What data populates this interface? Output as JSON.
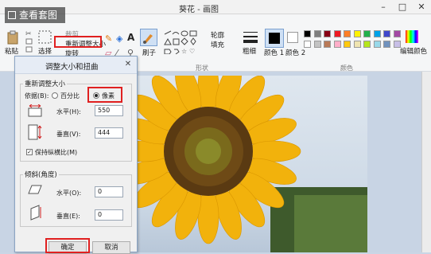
{
  "window": {
    "title": "葵花 - 画图",
    "watermark": "查看套图"
  },
  "ribbon": {
    "paste_label": "粘贴",
    "select_label": "选择",
    "crop_label": "裁剪",
    "resize_label": "重新调整大小",
    "rotate_label": "旋转",
    "brush_label": "刷子",
    "shapes_group": "形状",
    "outline_label": "轮廓",
    "fill_label": "填充",
    "size_label": "粗细",
    "color1_label": "颜色 1",
    "color2_label": "颜色 2",
    "colors_group": "颜色",
    "edit_colors_label": "编辑颜色",
    "palette": [
      "#000000",
      "#7f7f7f",
      "#880015",
      "#ed1c24",
      "#ff7f27",
      "#fff200",
      "#22b14c",
      "#00a2e8",
      "#3f48cc",
      "#a349a4",
      "#ffffff",
      "#c3c3c3",
      "#b97a57",
      "#ffaec9",
      "#ffc90e",
      "#efe4b0",
      "#b5e61d",
      "#99d9ea",
      "#7092be",
      "#c8bfe7"
    ]
  },
  "dialog": {
    "title": "调整大小和扭曲",
    "resize_section": "重新调整大小",
    "by_label": "依据(B):",
    "percent_label": "百分比",
    "pixel_label": "像素",
    "horizontal_label": "水平(H):",
    "horizontal_value": "550",
    "vertical_label": "垂直(V):",
    "vertical_value": "444",
    "keep_ratio_label": "保持纵横比(M)",
    "skew_section": "倾斜(角度)",
    "skew_h_label": "水平(O):",
    "skew_h_value": "0",
    "skew_v_label": "垂直(E):",
    "skew_v_value": "0",
    "ok_label": "确定",
    "cancel_label": "取消"
  }
}
